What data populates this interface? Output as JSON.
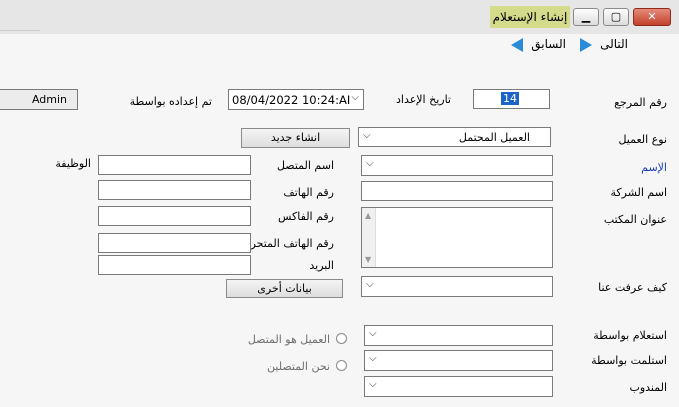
{
  "window": {
    "title": "إنشاء الإستعلام",
    "min_glyph": "▁",
    "max_glyph": "▢",
    "close_glyph": "✕"
  },
  "nav": {
    "next_label": "التالى",
    "prev_label": "السابق"
  },
  "form": {
    "ref_no": {
      "label": "رقم المرجع",
      "value": "14"
    },
    "prep_date": {
      "label": "تاريخ الإعداد",
      "value": "08/04/2022 10:24:AI"
    },
    "prepared_by": {
      "label": "تم إعداده بواسطة",
      "value": "Admin"
    },
    "client_type": {
      "label": "نوع العميل",
      "value": "العميل المحتمل"
    },
    "create_new_label": "انشاء جديد",
    "name_label": "الإسم",
    "contact_name_label": "اسم المتصل",
    "job_label": "الوظيفة",
    "company_label": "اسم الشركة",
    "phone_label": "رقم الهاتف",
    "office_address_label": "عنوان المكتب",
    "fax_label": "رقم الفاكس",
    "mobile_label": "رقم الهاتف المتحرك",
    "email_label": "البريد",
    "how_know_label": "كيف عرفت عنا",
    "more_data_label": "بيانات أخرى",
    "inquiry_by_label": "استعلام بواسطة",
    "received_by_label": "استلمت بواسطة",
    "rep_label": "المندوب",
    "radio_client_contact": "العميل هو المتصل",
    "radio_we_contact": "نحن المتصلين"
  }
}
